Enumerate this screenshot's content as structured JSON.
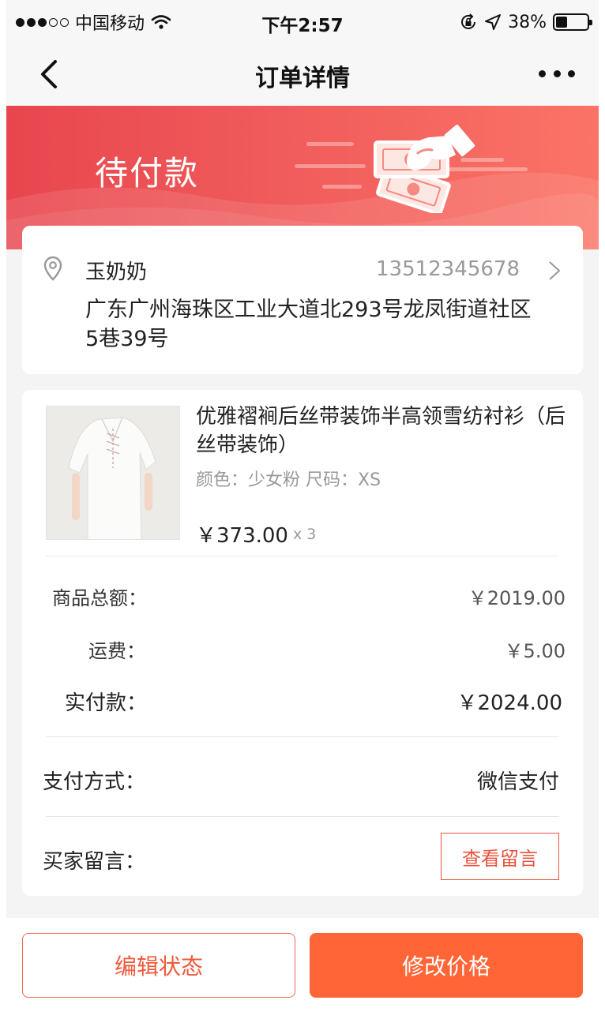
{
  "status_bar": {
    "carrier": "中国移动",
    "time": "下午2:57",
    "battery_text": "38%",
    "battery_level": 0.38,
    "signal_bars": 3,
    "signal_total": 5
  },
  "nav": {
    "title": "订单详情",
    "back_icon": "chevron-left-icon",
    "more_icon": "more-dots-icon"
  },
  "banner": {
    "status_title": "待付款",
    "illustration": "hand-with-banknotes-icon"
  },
  "address": {
    "name": "玉奶奶",
    "phone": "13512345678",
    "address": "广东广州海珠区工业大道北293号龙凤街道社区5巷39号"
  },
  "product": {
    "name": "优雅褶裥后丝带装饰半高领雪纺衬衫（后丝带装饰）",
    "spec": "颜色：少女粉  尺码：XS",
    "price": "￥373.00",
    "quantity": "x 3"
  },
  "summary": {
    "subtotal_label": "商品总额：",
    "subtotal_value": "￥2019.00",
    "shipping_label": "运费：",
    "shipping_value": "￥5.00",
    "paid_label": "实付款：",
    "paid_value": "￥2024.00"
  },
  "payment": {
    "label": "支付方式：",
    "value": "微信支付"
  },
  "message": {
    "label": "买家留言：",
    "button": "查看留言"
  },
  "actions": {
    "edit_status": "编辑状态",
    "modify_price": "修改价格"
  },
  "colors": {
    "banner_start": "#e8464e",
    "banner_end": "#fb7366",
    "accent": "#ff6536",
    "outline": "#ef6a4f"
  }
}
